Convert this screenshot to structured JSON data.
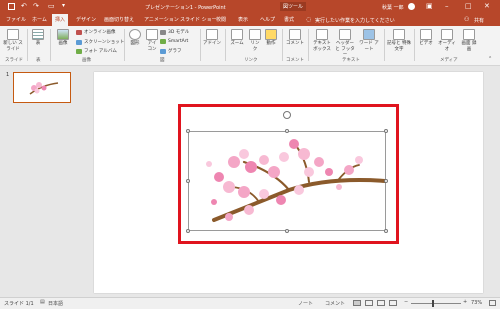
{
  "titlebar": {
    "title": "プレゼンテーション1 - PowerPoint",
    "context_tab": "図ツール",
    "search": "実行したい作業を入力してください",
    "user": "秋葉 一郎",
    "share": "共有"
  },
  "tabs": [
    {
      "label": "ファイル"
    },
    {
      "label": "ホーム"
    },
    {
      "label": "挿入"
    },
    {
      "label": "デザイン"
    },
    {
      "label": "画面切り替え"
    },
    {
      "label": "アニメーション"
    },
    {
      "label": "スライド ショー"
    },
    {
      "label": "校閲"
    },
    {
      "label": "表示"
    },
    {
      "label": "ヘルプ"
    },
    {
      "label": "書式"
    }
  ],
  "ribbon": {
    "new_slide": "新しい スライド",
    "table": "表",
    "image": "画像",
    "online_image": "オンライン画像",
    "screenshot": "スクリーンショット",
    "album": "フォト アルバム",
    "shapes": "図形",
    "icons": "アイ コン",
    "model3d": "3D モデル",
    "smartart": "SmartArt",
    "graph": "グラフ",
    "addin": "アドイン",
    "zoom": "ズーム",
    "link": "リン ク",
    "action": "動作",
    "comment": "コメント",
    "textbox": "テキスト ボックス",
    "header": "ヘッダーと フッター",
    "wordart": "ワード アート",
    "symbols": "記号と 特殊文字",
    "video": "ビデオ",
    "audio": "オーディオ",
    "screen_record": "画面 録画",
    "groups": {
      "slides": "スライド",
      "table": "表",
      "images": "画像",
      "diagrams": "図",
      "link": "リンク",
      "comment": "コメント",
      "text": "テキスト",
      "media": "メディア"
    }
  },
  "thumbnail_number": "1",
  "status": {
    "slide": "スライド 1/1",
    "lang": "日本語",
    "notes": "ノート",
    "comments": "コメント",
    "zoom": "73%"
  }
}
